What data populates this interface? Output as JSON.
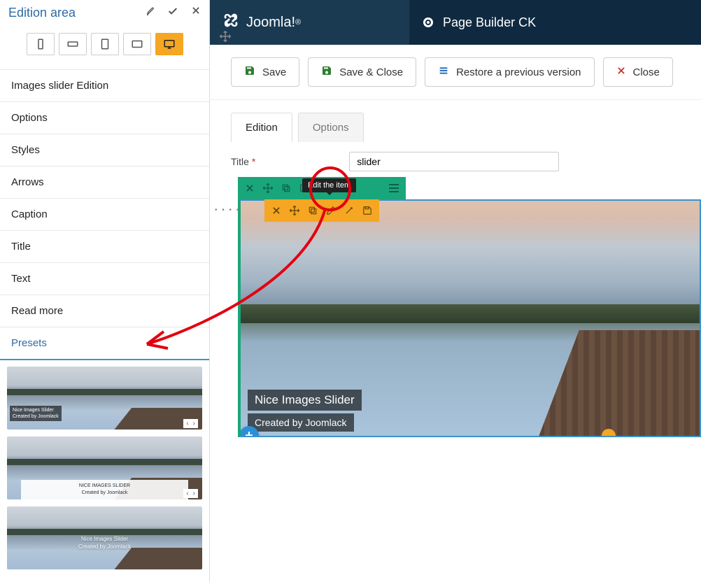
{
  "sidebar": {
    "title": "Edition area",
    "sections": [
      "Images slider Edition",
      "Options",
      "Styles",
      "Arrows",
      "Caption",
      "Title",
      "Text",
      "Read more",
      "Presets"
    ],
    "preset1": {
      "title": "Nice Images Slider",
      "subtitle": "Created by Joomlack"
    },
    "preset2": {
      "title": "NICE IMAGES SLIDER",
      "subtitle": "Created by Joomlack"
    },
    "preset3": {
      "title": "Nice Images Slider",
      "subtitle": "Created by Joomlack"
    }
  },
  "topbar": {
    "joomla": "Joomla!",
    "pagebuilder": "Page Builder CK"
  },
  "actions": {
    "save": "Save",
    "save_close": "Save & Close",
    "restore": "Restore a previous version",
    "close": "Close"
  },
  "tabs": {
    "edition": "Edition",
    "options": "Options"
  },
  "form": {
    "title_label": "Title",
    "title_value": "slider"
  },
  "tooltip": "Edit the item",
  "slide": {
    "caption": "Nice Images Slider",
    "subcaption": "Created by Joomlack"
  },
  "colors": {
    "accent_orange": "#f5a623",
    "accent_green": "#19a67a",
    "accent_blue": "#2a8fd6",
    "header_dark": "#1a3a52"
  }
}
